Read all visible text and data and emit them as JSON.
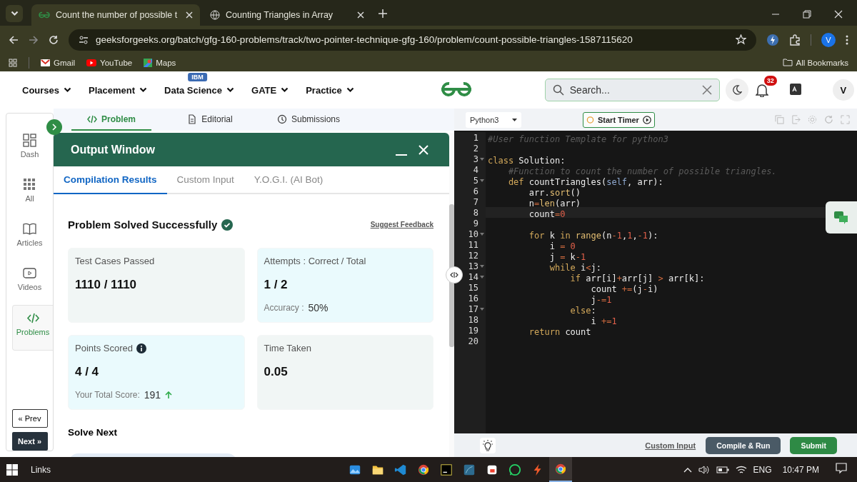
{
  "browser": {
    "tabs": [
      {
        "title": "Count the number of possible t",
        "selected": true
      },
      {
        "title": "Counting Triangles in Array",
        "selected": false
      }
    ],
    "url": "geeksforgeeks.org/batch/gfg-160-problems/track/two-pointer-technique-gfg-160/problem/count-possible-triangles-1587115620",
    "profile": "V",
    "bookmarks": [
      "Gmail",
      "YouTube",
      "Maps"
    ],
    "all_bookmarks": "All Bookmarks"
  },
  "site_nav": {
    "menus": [
      {
        "label": "Courses"
      },
      {
        "label": "Placement"
      },
      {
        "label": "Data Science",
        "badge": "IBM"
      },
      {
        "label": "GATE"
      },
      {
        "label": "Practice"
      }
    ],
    "search": {
      "placeholder": "Search..."
    },
    "notifications": "32",
    "avatar": "V"
  },
  "sidebar": {
    "items": [
      {
        "label": "Dash",
        "selected": false
      },
      {
        "label": "All",
        "selected": false
      },
      {
        "label": "Articles",
        "selected": false
      },
      {
        "label": "Videos",
        "selected": false
      },
      {
        "label": "Problems",
        "selected": true
      }
    ],
    "prev": "« Prev",
    "next": "Next »"
  },
  "problem_tabs": [
    {
      "label": "Problem",
      "selected": true
    },
    {
      "label": "Editorial",
      "selected": false
    },
    {
      "label": "Submissions",
      "selected": false
    }
  ],
  "output_window": {
    "title": "Output Window",
    "tabs": [
      {
        "label": "Compilation Results",
        "selected": true
      },
      {
        "label": "Custom Input",
        "selected": false
      },
      {
        "label": "Y.O.G.I. (AI Bot)",
        "selected": false
      }
    ],
    "status": "Problem Solved Successfully",
    "feedback_link": "Suggest Feedback",
    "cards": [
      {
        "label": "Test Cases Passed",
        "value": "1110 / 1110",
        "color": "#f1f6f5"
      },
      {
        "label": "Attempts : Correct / Total",
        "value": "1 / 2",
        "note_label": "Accuracy :",
        "note_value": "50%",
        "color": "#eafafd"
      },
      {
        "label": "Points Scored",
        "info": true,
        "value": "4 / 4",
        "note_label": "Your Total Score:",
        "note_value": "191",
        "rising": true,
        "color": "#eafafd"
      },
      {
        "label": "Time Taken",
        "value": "0.05",
        "color": "#f1f6f5"
      }
    ],
    "solve_next": "Solve Next"
  },
  "editor": {
    "language": "Python3",
    "timer": "Start Timer",
    "lines": [
      {
        "number": "1",
        "fold": false,
        "current": false,
        "tokens": [
          {
            "kind": "comment",
            "text": "#User function Template for python3"
          }
        ]
      },
      {
        "number": "2",
        "fold": false,
        "current": false
      },
      {
        "number": "3",
        "fold": true,
        "current": false,
        "tokens": [
          {
            "kind": "keyword",
            "text": "class"
          },
          {
            "kind": "plain",
            "text": " Solution:"
          }
        ]
      },
      {
        "number": "4",
        "fold": false,
        "current": false,
        "tokens": [
          {
            "kind": "comment",
            "text": "    #Function to count the number of possible triangles."
          }
        ]
      },
      {
        "number": "5",
        "fold": true,
        "current": false,
        "tokens": [
          {
            "kind": "keyword",
            "text": "    def"
          },
          {
            "kind": "plain",
            "text": " countTriangles("
          },
          {
            "kind": "self",
            "text": "self"
          },
          {
            "kind": "plain",
            "text": ", arr):"
          }
        ]
      },
      {
        "number": "6",
        "fold": false,
        "current": false,
        "tokens": [
          {
            "kind": "plain",
            "text": "        arr."
          },
          {
            "kind": "builtin",
            "text": "sort"
          },
          {
            "kind": "plain",
            "text": "()"
          }
        ]
      },
      {
        "number": "7",
        "fold": false,
        "current": false,
        "tokens": [
          {
            "kind": "plain",
            "text": "        n"
          },
          {
            "kind": "operator",
            "text": "="
          },
          {
            "kind": "builtin",
            "text": "len"
          },
          {
            "kind": "plain",
            "text": "(arr)"
          }
        ]
      },
      {
        "number": "8",
        "fold": false,
        "current": true,
        "tokens": [
          {
            "kind": "plain",
            "text": "        count"
          },
          {
            "kind": "operator",
            "text": "="
          },
          {
            "kind": "number",
            "text": "0"
          }
        ]
      },
      {
        "number": "9",
        "fold": false,
        "current": false
      },
      {
        "number": "10",
        "fold": true,
        "current": false,
        "tokens": [
          {
            "kind": "keyword",
            "text": "        for"
          },
          {
            "kind": "plain",
            "text": " k "
          },
          {
            "kind": "keyword",
            "text": "in"
          },
          {
            "kind": "builtin",
            "text": " range"
          },
          {
            "kind": "plain",
            "text": "(n"
          },
          {
            "kind": "operator",
            "text": "-"
          },
          {
            "kind": "number",
            "text": "1"
          },
          {
            "kind": "plain",
            "text": ","
          },
          {
            "kind": "number",
            "text": "1"
          },
          {
            "kind": "plain",
            "text": ","
          },
          {
            "kind": "operator",
            "text": "-"
          },
          {
            "kind": "number",
            "text": "1"
          },
          {
            "kind": "plain",
            "text": "):"
          }
        ]
      },
      {
        "number": "11",
        "fold": false,
        "current": false,
        "tokens": [
          {
            "kind": "plain",
            "text": "            i "
          },
          {
            "kind": "operator",
            "text": "="
          },
          {
            "kind": "number",
            "text": " 0"
          }
        ]
      },
      {
        "number": "12",
        "fold": false,
        "current": false,
        "tokens": [
          {
            "kind": "plain",
            "text": "            j "
          },
          {
            "kind": "operator",
            "text": "="
          },
          {
            "kind": "plain",
            "text": " k"
          },
          {
            "kind": "operator",
            "text": "-"
          },
          {
            "kind": "number",
            "text": "1"
          }
        ]
      },
      {
        "number": "13",
        "fold": true,
        "current": false,
        "tokens": [
          {
            "kind": "keyword",
            "text": "            while"
          },
          {
            "kind": "plain",
            "text": " i"
          },
          {
            "kind": "operator",
            "text": "<"
          },
          {
            "kind": "plain",
            "text": "j:"
          }
        ]
      },
      {
        "number": "14",
        "fold": true,
        "current": false,
        "tokens": [
          {
            "kind": "keyword",
            "text": "                if"
          },
          {
            "kind": "plain",
            "text": " arr[i]"
          },
          {
            "kind": "operator",
            "text": "+"
          },
          {
            "kind": "plain",
            "text": "arr[j] "
          },
          {
            "kind": "operator",
            "text": ">"
          },
          {
            "kind": "plain",
            "text": " arr[k]:"
          }
        ]
      },
      {
        "number": "15",
        "fold": false,
        "current": false,
        "tokens": [
          {
            "kind": "plain",
            "text": "                    count "
          },
          {
            "kind": "operator",
            "text": "+="
          },
          {
            "kind": "plain",
            "text": "(j"
          },
          {
            "kind": "operator",
            "text": "-"
          },
          {
            "kind": "plain",
            "text": "i)"
          }
        ]
      },
      {
        "number": "16",
        "fold": false,
        "current": false,
        "tokens": [
          {
            "kind": "plain",
            "text": "                    j"
          },
          {
            "kind": "operator",
            "text": "-="
          },
          {
            "kind": "number",
            "text": "1"
          }
        ]
      },
      {
        "number": "17",
        "fold": true,
        "current": false,
        "tokens": [
          {
            "kind": "keyword",
            "text": "                else"
          },
          {
            "kind": "plain",
            "text": ":"
          }
        ]
      },
      {
        "number": "18",
        "fold": false,
        "current": false,
        "tokens": [
          {
            "kind": "plain",
            "text": "                    i "
          },
          {
            "kind": "operator",
            "text": "+="
          },
          {
            "kind": "number",
            "text": "1"
          }
        ]
      },
      {
        "number": "19",
        "fold": false,
        "current": false,
        "tokens": [
          {
            "kind": "keyword",
            "text": "        return"
          },
          {
            "kind": "plain",
            "text": " count"
          }
        ]
      },
      {
        "number": "20",
        "fold": false,
        "current": false
      }
    ],
    "custom_input": "Custom Input",
    "compile": "Compile & Run",
    "submit": "Submit"
  },
  "taskbar": {
    "links": "Links",
    "language": "ENG",
    "time": "10:47 PM"
  }
}
